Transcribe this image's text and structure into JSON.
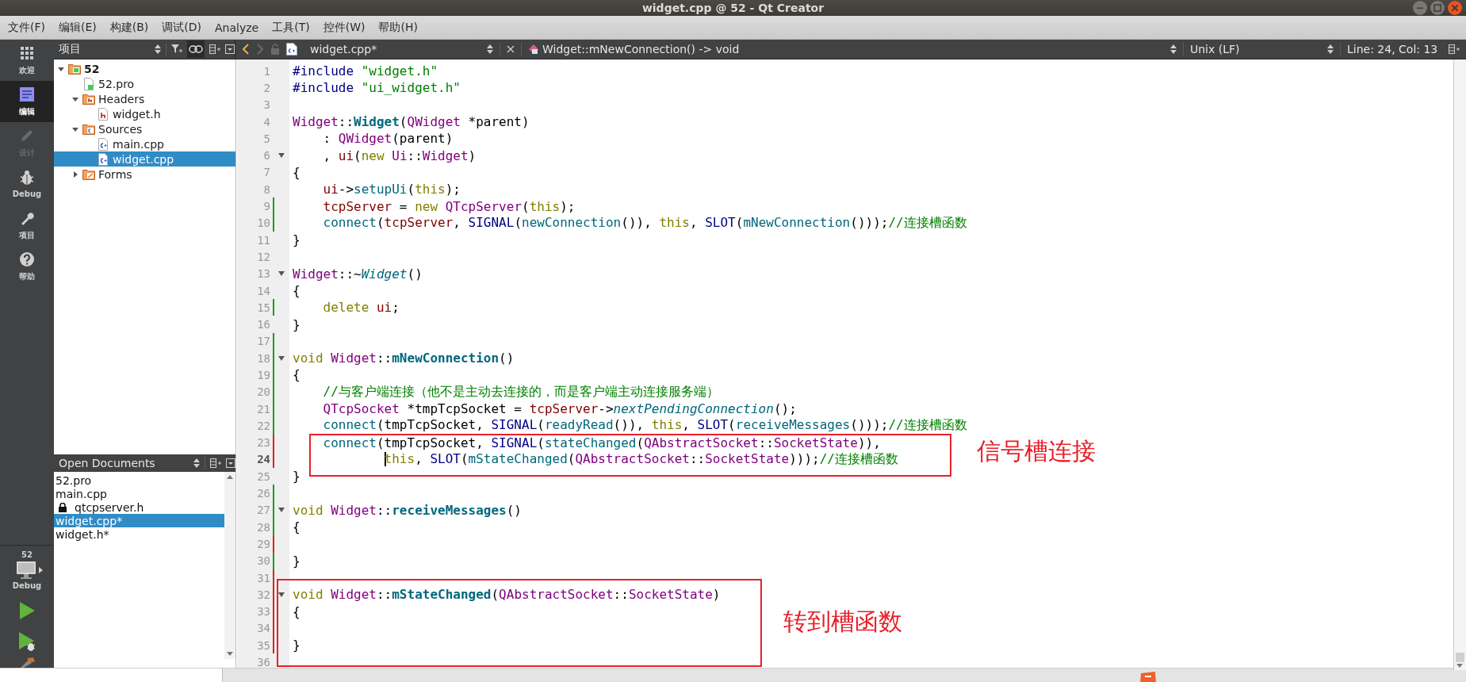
{
  "window": {
    "title": "widget.cpp @ 52 - Qt Creator"
  },
  "menu": [
    "文件(F)",
    "编辑(E)",
    "构建(B)",
    "调试(D)",
    "Analyze",
    "工具(T)",
    "控件(W)",
    "帮助(H)"
  ],
  "modes": [
    {
      "kind": "welcome",
      "label": "欢迎",
      "selected": false,
      "disabled": false
    },
    {
      "kind": "edit",
      "label": "编辑",
      "selected": true,
      "disabled": false
    },
    {
      "kind": "design",
      "label": "设计",
      "selected": false,
      "disabled": true
    },
    {
      "kind": "debug",
      "label": "Debug",
      "selected": false,
      "disabled": false
    },
    {
      "kind": "projects",
      "label": "项目",
      "selected": false,
      "disabled": false
    },
    {
      "kind": "help",
      "label": "帮助",
      "selected": false,
      "disabled": false
    }
  ],
  "target": {
    "project": "52",
    "build": "Debug"
  },
  "project_panel": {
    "title": "项目",
    "tree": [
      {
        "label": "52",
        "kind": "project",
        "expanded": true,
        "selected": false,
        "children": [
          {
            "label": "52.pro",
            "kind": "pro-file",
            "selected": false
          },
          {
            "label": "Headers",
            "kind": "headers",
            "expanded": true,
            "selected": false,
            "children": [
              {
                "label": "widget.h",
                "kind": "header-file",
                "selected": false
              }
            ]
          },
          {
            "label": "Sources",
            "kind": "sources",
            "expanded": true,
            "selected": false,
            "children": [
              {
                "label": "main.cpp",
                "kind": "source-file",
                "selected": false
              },
              {
                "label": "widget.cpp",
                "kind": "source-file",
                "selected": true
              }
            ]
          },
          {
            "label": "Forms",
            "kind": "forms",
            "expanded": false,
            "selected": false
          }
        ]
      }
    ]
  },
  "open_documents": {
    "title": "Open Documents",
    "items": [
      {
        "label": "52.pro",
        "locked": false,
        "selected": false
      },
      {
        "label": "main.cpp",
        "locked": false,
        "selected": false
      },
      {
        "label": "qtcpserver.h",
        "locked": true,
        "selected": false
      },
      {
        "label": "widget.cpp*",
        "locked": false,
        "selected": true
      },
      {
        "label": "widget.h*",
        "locked": false,
        "selected": false
      }
    ]
  },
  "editor_toolbar": {
    "back_enabled": true,
    "forward_enabled": false,
    "file": "widget.cpp*",
    "symbol": "Widget::mNewConnection() -> void",
    "line_ending": "Unix (LF)",
    "position": "Line: 24, Col: 13"
  },
  "code": [
    {
      "n": "1",
      "tokens": [
        {
          "kind": "pre",
          "text": "#include"
        },
        {
          "kind": "str",
          "text": " \"widget.h\""
        }
      ]
    },
    {
      "n": "2",
      "tokens": [
        {
          "kind": "pre",
          "text": "#include"
        },
        {
          "kind": "str",
          "text": " \"ui_widget.h\""
        }
      ]
    },
    {
      "n": "3"
    },
    {
      "n": "4",
      "tokens": [
        {
          "kind": "ty",
          "text": "Widget"
        },
        {
          "kind": "p",
          "text": "::"
        },
        {
          "kind": "fnb",
          "text": "Widget"
        },
        {
          "kind": "p",
          "text": "("
        },
        {
          "kind": "ty",
          "text": "QWidget"
        },
        {
          "kind": "p",
          "text": " *parent)"
        }
      ]
    },
    {
      "n": "5",
      "tokens": [
        {
          "kind": "p",
          "text": "    : "
        },
        {
          "kind": "ty",
          "text": "QWidget"
        },
        {
          "kind": "p",
          "text": "(parent)"
        }
      ]
    },
    {
      "n": "6",
      "foldable": true,
      "tokens": [
        {
          "kind": "p",
          "text": "    , "
        },
        {
          "kind": "mem",
          "text": "ui"
        },
        {
          "kind": "p",
          "text": "("
        },
        {
          "kind": "kw",
          "text": "new"
        },
        {
          "kind": "ty",
          "text": " Ui"
        },
        {
          "kind": "p",
          "text": "::"
        },
        {
          "kind": "ty",
          "text": "Widget"
        },
        {
          "kind": "p",
          "text": ")"
        }
      ]
    },
    {
      "n": "7",
      "tokens": [
        {
          "kind": "p",
          "text": "{"
        }
      ]
    },
    {
      "n": "8",
      "tokens": [
        {
          "kind": "mem",
          "text": "    ui"
        },
        {
          "kind": "p",
          "text": "->"
        },
        {
          "kind": "fn",
          "text": "setupUi"
        },
        {
          "kind": "p",
          "text": "("
        },
        {
          "kind": "kw",
          "text": "this"
        },
        {
          "kind": "p",
          "text": ");"
        }
      ]
    },
    {
      "n": "9",
      "modified": true,
      "saved": true,
      "tokens": [
        {
          "kind": "mem",
          "text": "    tcpServer"
        },
        {
          "kind": "p",
          "text": " = "
        },
        {
          "kind": "kw",
          "text": "new"
        },
        {
          "kind": "ty",
          "text": " QTcpServer"
        },
        {
          "kind": "p",
          "text": "("
        },
        {
          "kind": "kw",
          "text": "this"
        },
        {
          "kind": "p",
          "text": ");"
        }
      ]
    },
    {
      "n": "10",
      "modified": true,
      "saved": true,
      "tokens": [
        {
          "kind": "fn",
          "text": "    connect"
        },
        {
          "kind": "p",
          "text": "("
        },
        {
          "kind": "mem",
          "text": "tcpServer"
        },
        {
          "kind": "p",
          "text": ", "
        },
        {
          "kind": "mac",
          "text": "SIGNAL"
        },
        {
          "kind": "p",
          "text": "("
        },
        {
          "kind": "fn",
          "text": "newConnection"
        },
        {
          "kind": "p",
          "text": "()), "
        },
        {
          "kind": "kw",
          "text": "this"
        },
        {
          "kind": "p",
          "text": ", "
        },
        {
          "kind": "mac",
          "text": "SLOT"
        },
        {
          "kind": "p",
          "text": "("
        },
        {
          "kind": "fn",
          "text": "mNewConnection"
        },
        {
          "kind": "p",
          "text": "()));"
        },
        {
          "kind": "cm",
          "text": "//连接槽函数"
        }
      ]
    },
    {
      "n": "11",
      "tokens": [
        {
          "kind": "p",
          "text": "}"
        }
      ]
    },
    {
      "n": "12"
    },
    {
      "n": "13",
      "foldable": true,
      "tokens": [
        {
          "kind": "ty",
          "text": "Widget"
        },
        {
          "kind": "p",
          "text": "::~"
        },
        {
          "kind": "fni",
          "text": "Widget"
        },
        {
          "kind": "p",
          "text": "()"
        }
      ]
    },
    {
      "n": "14",
      "tokens": [
        {
          "kind": "p",
          "text": "{"
        }
      ]
    },
    {
      "n": "15",
      "modified": true,
      "saved": true,
      "tokens": [
        {
          "kind": "kw",
          "text": "    delete"
        },
        {
          "kind": "mem",
          "text": " ui"
        },
        {
          "kind": "p",
          "text": ";"
        }
      ]
    },
    {
      "n": "16",
      "tokens": [
        {
          "kind": "p",
          "text": "}"
        }
      ]
    },
    {
      "n": "17",
      "modified": true,
      "saved": true
    },
    {
      "n": "18",
      "modified": true,
      "saved": true,
      "foldable": true,
      "tokens": [
        {
          "kind": "kw",
          "text": "void"
        },
        {
          "kind": "ty",
          "text": " Widget"
        },
        {
          "kind": "p",
          "text": "::"
        },
        {
          "kind": "fnb",
          "text": "mNewConnection"
        },
        {
          "kind": "p",
          "text": "()"
        }
      ]
    },
    {
      "n": "19",
      "modified": true,
      "saved": true,
      "tokens": [
        {
          "kind": "p",
          "text": "{"
        }
      ]
    },
    {
      "n": "20",
      "modified": true,
      "saved": true,
      "tokens": [
        {
          "kind": "cm",
          "text": "    //与客户端连接（他不是主动去连接的，而是客户端主动连接服务端）"
        }
      ]
    },
    {
      "n": "21",
      "modified": true,
      "saved": true,
      "tokens": [
        {
          "kind": "ty",
          "text": "    QTcpSocket"
        },
        {
          "kind": "p",
          "text": " *tmpTcpSocket = "
        },
        {
          "kind": "mem",
          "text": "tcpServer"
        },
        {
          "kind": "p",
          "text": "->"
        },
        {
          "kind": "fni",
          "text": "nextPendingConnection"
        },
        {
          "kind": "p",
          "text": "();"
        }
      ]
    },
    {
      "n": "22",
      "modified": true,
      "saved": true,
      "tokens": [
        {
          "kind": "fn",
          "text": "    connect"
        },
        {
          "kind": "p",
          "text": "(tmpTcpSocket, "
        },
        {
          "kind": "mac",
          "text": "SIGNAL"
        },
        {
          "kind": "p",
          "text": "("
        },
        {
          "kind": "fn",
          "text": "readyRead"
        },
        {
          "kind": "p",
          "text": "()), "
        },
        {
          "kind": "kw",
          "text": "this"
        },
        {
          "kind": "p",
          "text": ", "
        },
        {
          "kind": "mac",
          "text": "SLOT"
        },
        {
          "kind": "p",
          "text": "("
        },
        {
          "kind": "fn",
          "text": "receiveMessages"
        },
        {
          "kind": "p",
          "text": "()));"
        },
        {
          "kind": "cm",
          "text": "//连接槽函数"
        }
      ]
    },
    {
      "n": "23",
      "modified": true,
      "saved": false,
      "tokens": [
        {
          "kind": "fn",
          "text": "    connect"
        },
        {
          "kind": "p",
          "text": "(tmpTcpSocket, "
        },
        {
          "kind": "mac",
          "text": "SIGNAL"
        },
        {
          "kind": "p",
          "text": "("
        },
        {
          "kind": "fn",
          "text": "stateChanged"
        },
        {
          "kind": "p",
          "text": "("
        },
        {
          "kind": "ty",
          "text": "QAbstractSocket"
        },
        {
          "kind": "p",
          "text": "::"
        },
        {
          "kind": "ty",
          "text": "SocketState"
        },
        {
          "kind": "p",
          "text": ")),"
        }
      ]
    },
    {
      "n": "24",
      "modified": true,
      "saved": false,
      "current": true,
      "tokens": [
        {
          "kind": "kw",
          "text": "            this"
        },
        {
          "kind": "p",
          "text": ", "
        },
        {
          "kind": "mac",
          "text": "SLOT"
        },
        {
          "kind": "p",
          "text": "("
        },
        {
          "kind": "fn",
          "text": "mStateChanged"
        },
        {
          "kind": "p",
          "text": "("
        },
        {
          "kind": "ty",
          "text": "QAbstractSocket"
        },
        {
          "kind": "p",
          "text": "::"
        },
        {
          "kind": "ty",
          "text": "SocketState"
        },
        {
          "kind": "p",
          "text": ")));"
        },
        {
          "kind": "cm",
          "text": "//连接槽函数"
        }
      ]
    },
    {
      "n": "25",
      "tokens": [
        {
          "kind": "p",
          "text": "}"
        }
      ]
    },
    {
      "n": "26",
      "modified": true,
      "saved": true
    },
    {
      "n": "27",
      "modified": true,
      "saved": true,
      "foldable": true,
      "tokens": [
        {
          "kind": "kw",
          "text": "void"
        },
        {
          "kind": "ty",
          "text": " Widget"
        },
        {
          "kind": "p",
          "text": "::"
        },
        {
          "kind": "fnb",
          "text": "receiveMessages"
        },
        {
          "kind": "p",
          "text": "()"
        }
      ]
    },
    {
      "n": "28",
      "modified": true,
      "saved": true,
      "tokens": [
        {
          "kind": "p",
          "text": "{"
        }
      ]
    },
    {
      "n": "29",
      "modified": true,
      "saved": false
    },
    {
      "n": "30",
      "modified": true,
      "saved": true,
      "tokens": [
        {
          "kind": "p",
          "text": "}"
        }
      ]
    },
    {
      "n": "31",
      "modified": true,
      "saved": false
    },
    {
      "n": "32",
      "modified": true,
      "saved": false,
      "foldable": true,
      "tokens": [
        {
          "kind": "kw",
          "text": "void"
        },
        {
          "kind": "ty",
          "text": " Widget"
        },
        {
          "kind": "p",
          "text": "::"
        },
        {
          "kind": "fnb",
          "text": "mStateChanged"
        },
        {
          "kind": "p",
          "text": "("
        },
        {
          "kind": "ty",
          "text": "QAbstractSocket"
        },
        {
          "kind": "p",
          "text": "::"
        },
        {
          "kind": "ty",
          "text": "SocketState"
        },
        {
          "kind": "p",
          "text": ")"
        }
      ]
    },
    {
      "n": "33",
      "modified": true,
      "saved": false,
      "tokens": [
        {
          "kind": "p",
          "text": "{"
        }
      ]
    },
    {
      "n": "34",
      "modified": true,
      "saved": false
    },
    {
      "n": "35",
      "modified": true,
      "saved": false,
      "tokens": [
        {
          "kind": "p",
          "text": "}"
        }
      ]
    },
    {
      "n": "36"
    }
  ],
  "annotations": [
    {
      "text": "信号槽连接"
    },
    {
      "text": "转到槽函数"
    }
  ]
}
